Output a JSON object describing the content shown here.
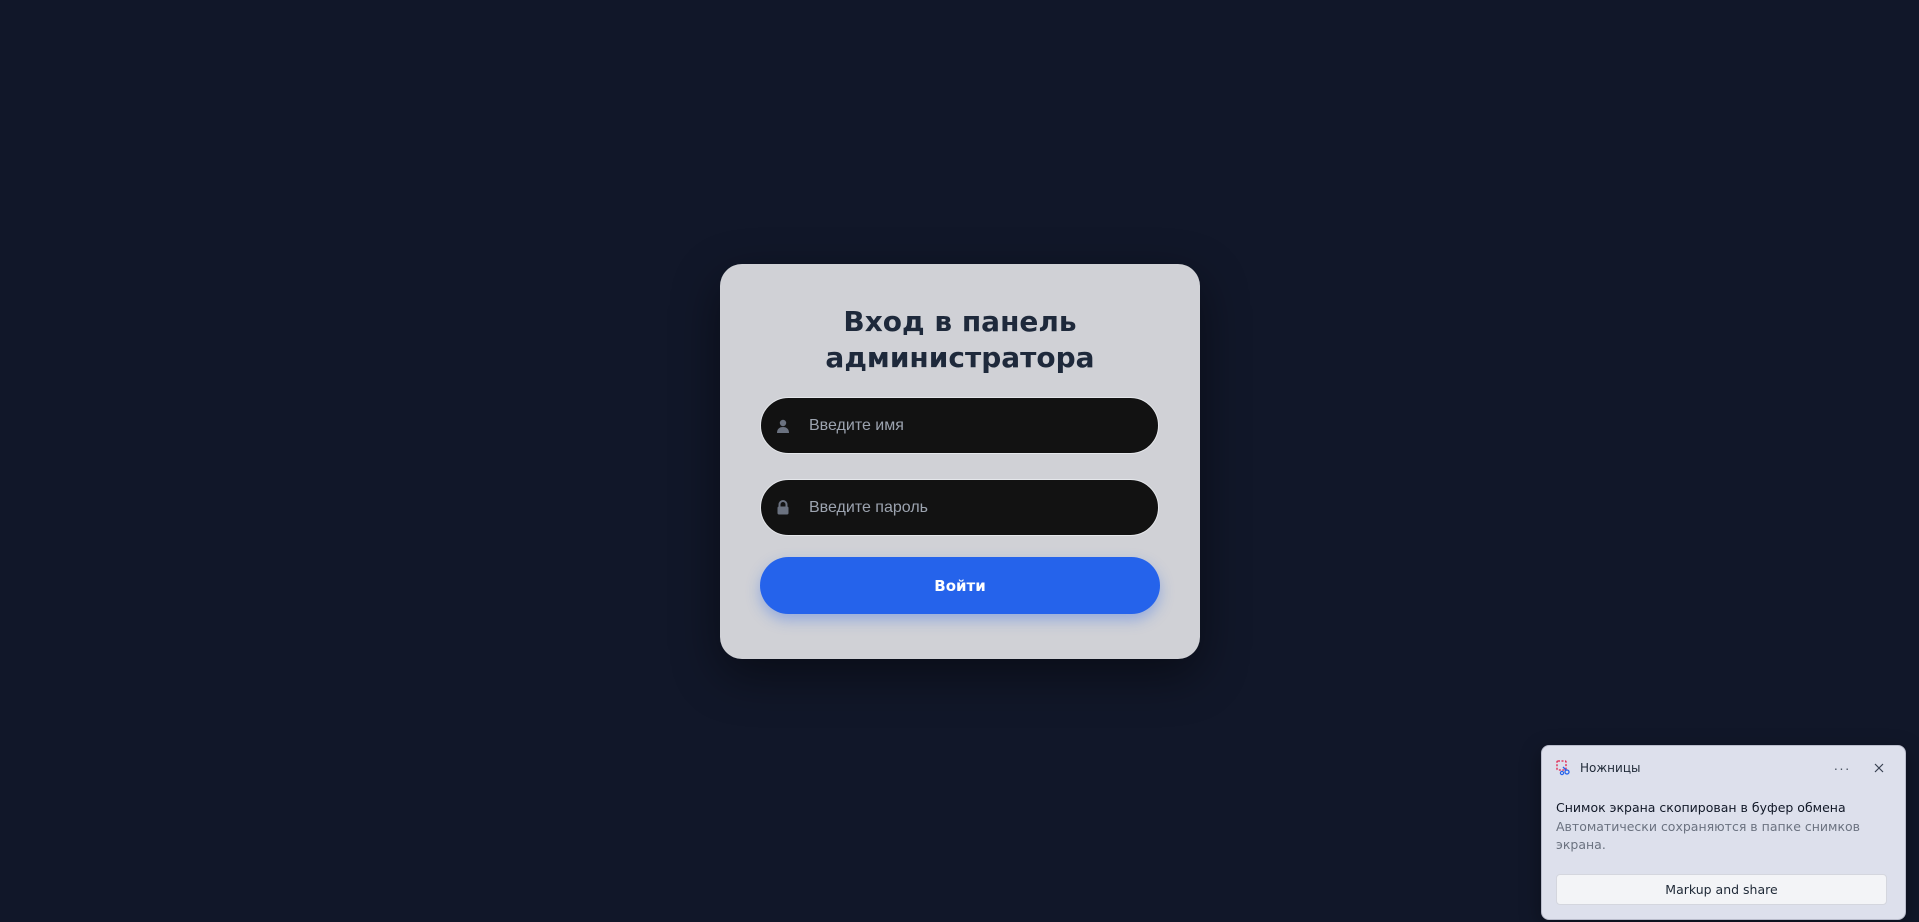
{
  "login": {
    "title": "Вход в панель администратора",
    "username_placeholder": "Введите имя",
    "username_value": "",
    "password_placeholder": "Введите пароль",
    "password_value": "",
    "submit_label": "Войти",
    "user_icon": "user-icon",
    "lock_icon": "lock-icon"
  },
  "toast": {
    "app_name": "Ножницы",
    "app_icon": "snipping-tool-icon",
    "more_label": "···",
    "title": "Снимок экрана скопирован в буфер обмена",
    "body": "Автоматически сохраняются в папке снимков экрана.",
    "button_label": "Markup and share"
  },
  "colors": {
    "background": "#111729",
    "card": "#d0d1d6",
    "accent": "#2563eb",
    "input_bg": "#121212"
  }
}
